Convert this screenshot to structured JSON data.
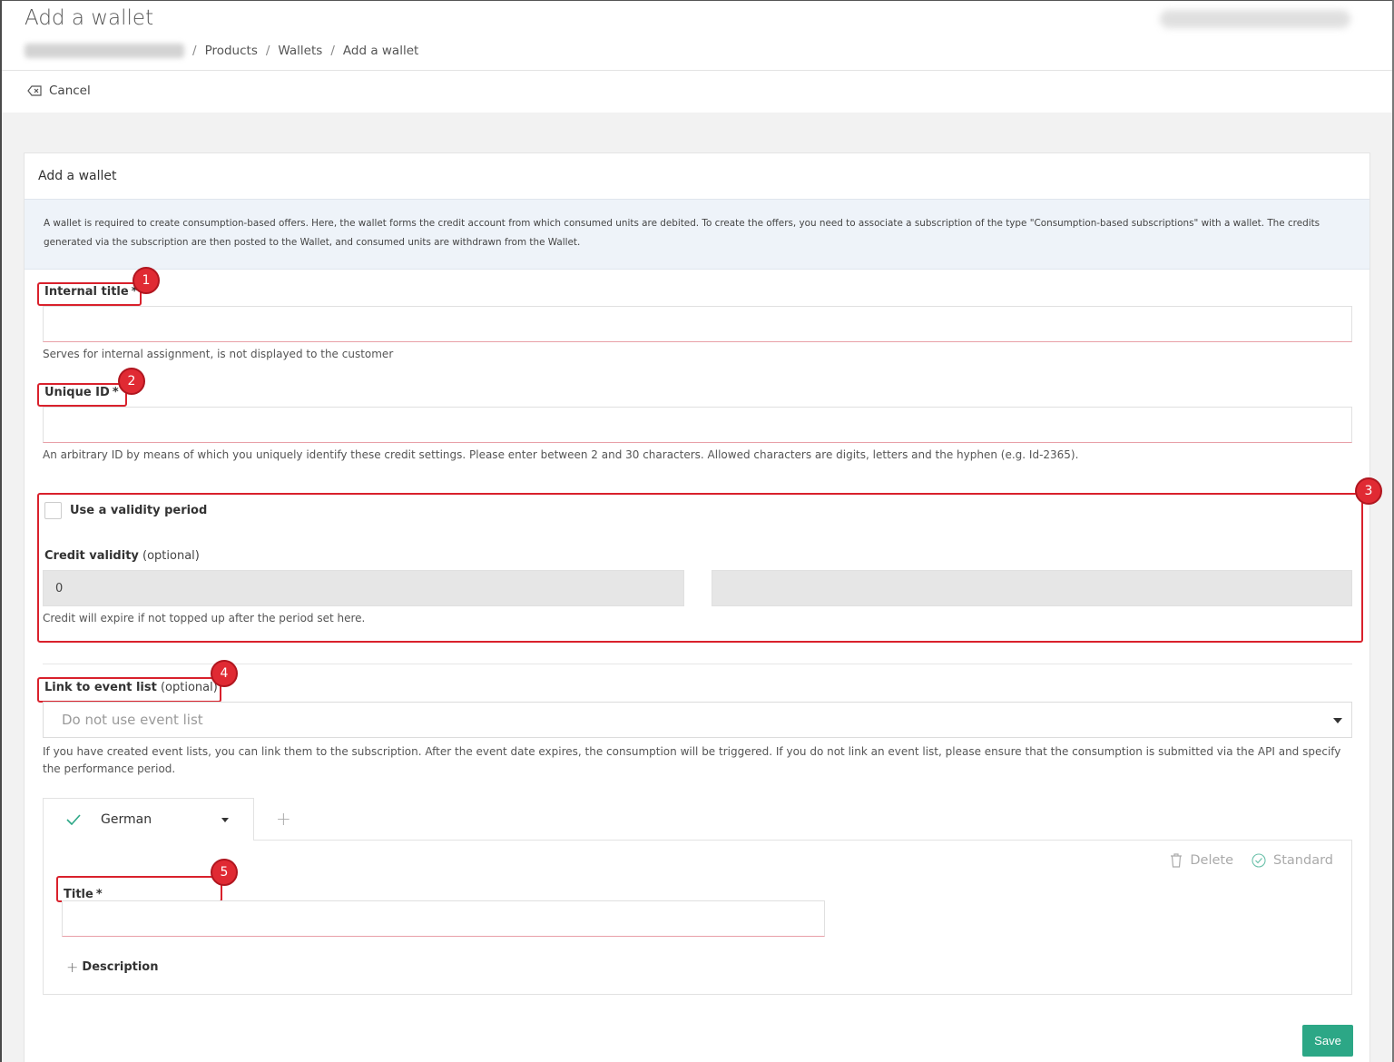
{
  "header": {
    "title": "Add a wallet",
    "breadcrumb": [
      "Products",
      "Wallets",
      "Add a wallet"
    ]
  },
  "toolbar": {
    "cancel_label": "Cancel"
  },
  "panel": {
    "title": "Add a wallet",
    "info": "A wallet is required to create consumption-based offers. Here, the wallet forms the credit account from which consumed units are debited. To create the offers, you need to associate a subscription of the type \"Consumption-based subscriptions\" with a wallet. The credits generated via the subscription are then posted to the Wallet, and consumed units are withdrawn from the Wallet."
  },
  "fields": {
    "internal_title": {
      "label": "Internal title",
      "required": "*",
      "value": "",
      "help": "Serves for internal assignment, is not displayed to the customer"
    },
    "unique_id": {
      "label": "Unique ID",
      "required": "*",
      "value": "",
      "help": "An arbitrary ID by means of which you uniquely identify these credit settings. Please enter between 2 and 30 characters. Allowed characters are digits, letters and the hyphen (e.g. Id-2365)."
    },
    "validity": {
      "checkbox_label": "Use a validity period",
      "checked": false,
      "credit_label": "Credit validity",
      "optional": "(optional)",
      "value": "0",
      "unit_value": "",
      "help": "Credit will expire if not topped up after the period set here."
    },
    "event_list": {
      "label": "Link to event list",
      "optional": "(optional)",
      "selected": "Do not use event list",
      "help": "If you have created event lists, you can link them to the subscription. After the event date expires, the consumption will be triggered. If you do not link an event list, please ensure that the consumption is submitted via the API and specify the performance period."
    }
  },
  "languages": {
    "active_tab": "German",
    "add_tab": "+",
    "delete_label": "Delete",
    "standard_label": "Standard",
    "title_label": "Title",
    "title_required": "*",
    "title_value": "",
    "description_label": "Description",
    "description_plus": "+"
  },
  "annotations": [
    "1",
    "2",
    "3",
    "4",
    "5"
  ],
  "actions": {
    "save_label": "Save"
  },
  "colors": {
    "accent": "#2ca786",
    "annotation": "#d9212c",
    "info_bg": "#eef3f9"
  },
  "icons": [
    "cancel-icon",
    "check-icon",
    "trash-icon",
    "circle-check-icon",
    "plus-icon",
    "chevron-down-icon"
  ]
}
